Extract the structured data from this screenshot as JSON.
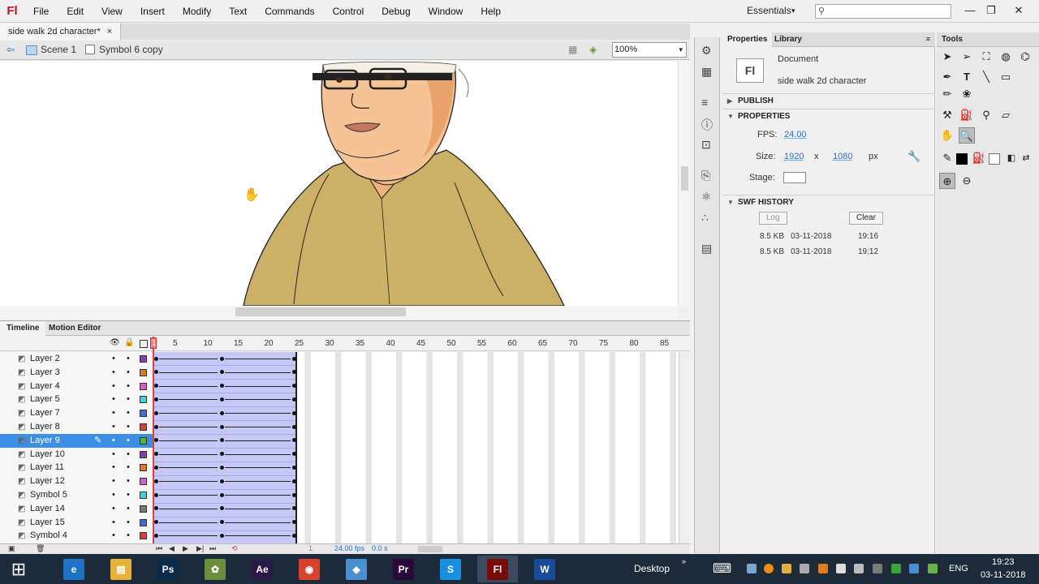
{
  "app": {
    "logo": "Fl"
  },
  "menu": [
    "File",
    "Edit",
    "View",
    "Insert",
    "Modify",
    "Text",
    "Commands",
    "Control",
    "Debug",
    "Window",
    "Help"
  ],
  "workspace": "Essentials",
  "window_controls": {
    "minimize": "—",
    "restore": "❐",
    "close": "✕"
  },
  "document": {
    "tab_title": "side walk 2d character*",
    "close_glyph": "×"
  },
  "editbar": {
    "scene": "Scene 1",
    "symbol": "Symbol 6 copy",
    "zoom": "100%"
  },
  "timeline": {
    "tabs": [
      "Timeline",
      "Motion Editor"
    ],
    "frame_numbers": [
      "1",
      "5",
      "10",
      "15",
      "20",
      "25",
      "30",
      "35",
      "40",
      "45",
      "50",
      "55",
      "60",
      "65",
      "70",
      "75",
      "80",
      "85"
    ],
    "layers": [
      {
        "name": "Layer 2",
        "color": "#8a3bb8"
      },
      {
        "name": "Layer 3",
        "color": "#e07b1a"
      },
      {
        "name": "Layer 4",
        "color": "#e055d0"
      },
      {
        "name": "Layer 5",
        "color": "#3ad6e0"
      },
      {
        "name": "Layer 7",
        "color": "#3a6ee0"
      },
      {
        "name": "Layer 8",
        "color": "#e03a3a"
      },
      {
        "name": "Layer 9",
        "color": "#3ac43a",
        "selected": true
      },
      {
        "name": "Layer 10",
        "color": "#8a3bb8"
      },
      {
        "name": "Layer 11",
        "color": "#e07b1a"
      },
      {
        "name": "Layer 12",
        "color": "#e055d0"
      },
      {
        "name": "Symbol 5",
        "color": "#3ad6e0"
      },
      {
        "name": "Layer 14",
        "color": "#777777"
      },
      {
        "name": "Layer 15",
        "color": "#3a6ee0"
      },
      {
        "name": "Symbol 4",
        "color": "#e03a3a"
      }
    ],
    "footer": {
      "frame": "1",
      "fps": "24.00 fps",
      "time": "0.0 s"
    }
  },
  "properties": {
    "tabs": [
      "Properties",
      "Library"
    ],
    "doc_type": "Document",
    "doc_name": "side walk 2d character",
    "publish_header": "PUBLISH",
    "properties_header": "PROPERTIES",
    "fps_label": "FPS:",
    "fps_value": "24.00",
    "size_label": "Size:",
    "width": "1920",
    "times": "x",
    "height": "1080",
    "unit": "px",
    "stage_label": "Stage:",
    "stage_color": "#ffffff",
    "swf_header": "SWF HISTORY",
    "log_button": "Log",
    "clear_button": "Clear",
    "history": [
      {
        "size": "8.5 KB",
        "date": "03-11-2018",
        "time": "19:16"
      },
      {
        "size": "8.5 KB",
        "date": "03-11-2018",
        "time": "19:12"
      }
    ]
  },
  "tools": {
    "title": "Tools"
  },
  "taskbar": {
    "desktop_label": "Desktop",
    "lang": "ENG",
    "time": "19:23",
    "date": "03-11-2018",
    "apps": [
      {
        "name": "ie",
        "label": "e",
        "bg": "#1e73c8"
      },
      {
        "name": "explorer",
        "label": "▤",
        "bg": "#e8b23a"
      },
      {
        "name": "photoshop",
        "label": "Ps",
        "bg": "#0a2b4a"
      },
      {
        "name": "paint",
        "label": "✿",
        "bg": "#6a8f3a"
      },
      {
        "name": "after-effects",
        "label": "Ae",
        "bg": "#2a1a4a"
      },
      {
        "name": "chrome",
        "label": "◉",
        "bg": "#d9412c"
      },
      {
        "name": "tool",
        "label": "◆",
        "bg": "#4a8fd0"
      },
      {
        "name": "premiere",
        "label": "Pr",
        "bg": "#2a0a3a"
      },
      {
        "name": "skype",
        "label": "S",
        "bg": "#1a8fe0"
      },
      {
        "name": "flash",
        "label": "Fl",
        "bg": "#7a0a0a"
      },
      {
        "name": "word",
        "label": "W",
        "bg": "#1a4a9a"
      }
    ]
  }
}
